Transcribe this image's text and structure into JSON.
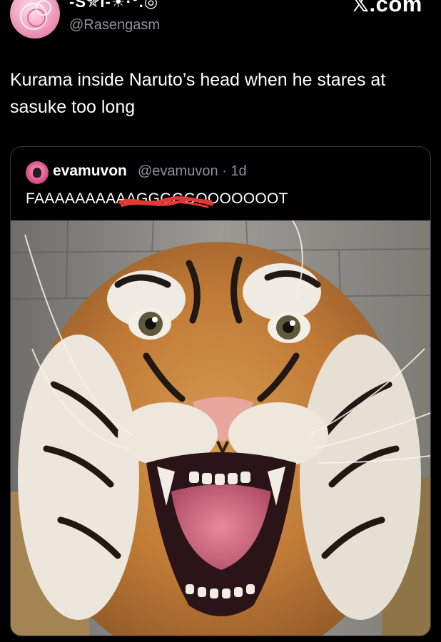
{
  "post": {
    "author": {
      "display_name": "-S✯I-☀·°.◎",
      "handle": "@Rasengasm"
    },
    "text": "Kurama inside Naruto’s head when he stares at sasuke too long",
    "watermark": "𝕏.com"
  },
  "quoted_post": {
    "author": {
      "display_name": "evamuvon",
      "handle": "@evamuvon",
      "time": "1d"
    },
    "meta": "@evamuvon · 1d",
    "text": "FAAAAAAAAAAGGGGGOOOOOOOT",
    "media": {
      "description_icon": "tiger-photo",
      "colors": {
        "wall": "#8b8a85",
        "fur_orange": "#c8873f",
        "fur_white": "#ece6dc",
        "stripe": "#1f1813",
        "tongue": "#d9738a",
        "scribble": "#e03a35"
      }
    }
  }
}
